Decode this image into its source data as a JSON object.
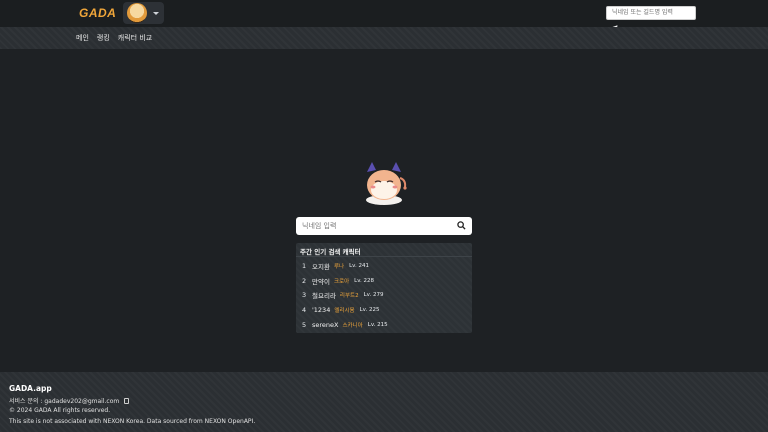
{
  "header": {
    "logo": "GADA",
    "search_placeholder": "닉네임 또는 길드명 입력"
  },
  "nav": {
    "items": [
      "메인",
      "랭킹",
      "캐릭터 비교"
    ]
  },
  "main": {
    "search_placeholder": "닉네임 입력",
    "popular_title": "주간 인기 검색 캐릭터",
    "popular": [
      {
        "rank": "1",
        "name": "오지환",
        "job": "루나",
        "level": "Lv. 241"
      },
      {
        "rank": "2",
        "name": "만약이",
        "job": "크로아",
        "level": "Lv. 228"
      },
      {
        "rank": "3",
        "name": "철요리라",
        "job": "리부트2",
        "level": "Lv. 279"
      },
      {
        "rank": "4",
        "name": "'1234",
        "job": "엘리시움",
        "level": "Lv. 225"
      },
      {
        "rank": "5",
        "name": "sereneX",
        "job": "스카니아",
        "level": "Lv. 215"
      }
    ]
  },
  "footer": {
    "brand": "GADA.app",
    "contact_label": "서비스 문의 :",
    "contact_email": "gadadev202@gmail.com",
    "copyright": "© 2024 GADA All rights reserved.",
    "disclaimer": "This site is not associated with NEXON Korea. Data sourced from NEXON OpenAPI."
  },
  "colors": {
    "accent": "#f0a63a",
    "background": "#1e2124",
    "panel": "#2d3236"
  },
  "icons": {
    "search": "search-icon",
    "copy": "copy-icon",
    "caret": "chevron-down-icon"
  }
}
